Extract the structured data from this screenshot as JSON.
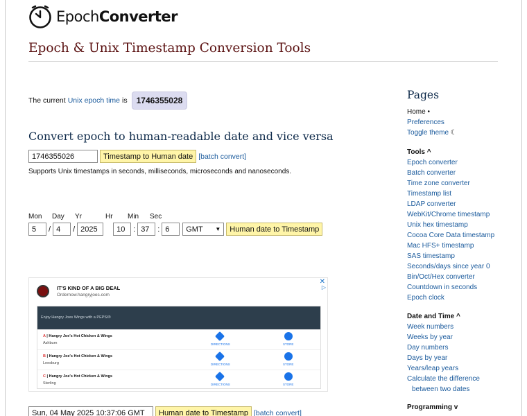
{
  "logo": {
    "text_light": "Epoch",
    "text_bold": "Converter"
  },
  "page_title": "Epoch & Unix Timestamp Conversion Tools",
  "current": {
    "prefix": "The current",
    "link": "Unix epoch time",
    "suffix": "is",
    "value": "1746355028"
  },
  "convert": {
    "heading": "Convert epoch to human-readable date and vice versa",
    "input_value": "1746355026",
    "button": "Timestamp to Human date",
    "batch": "[batch convert]",
    "support": "Supports Unix timestamps in seconds, milliseconds, microseconds and nanoseconds."
  },
  "date_form": {
    "labels": {
      "mon": "Mon",
      "day": "Day",
      "yr": "Yr",
      "hr": "Hr",
      "min": "Min",
      "sec": "Sec"
    },
    "values": {
      "mon": "5",
      "day": "4",
      "yr": "2025",
      "hr": "10",
      "min": "37",
      "sec": "6"
    },
    "sep_date": "/",
    "sep_time": ":",
    "timezone": "GMT",
    "button": "Human date to Timestamp"
  },
  "ad": {
    "headline": "IT'S KIND OF A BIG DEAL",
    "sub": "Ordernow.hangryjoes.com",
    "bar": "Enjoy Hangry Joes Wings with a PEPSI®",
    "directions": "DIRECTIONS",
    "store": "STORE",
    "close": "✕",
    "choices": "▷",
    "rows": [
      {
        "letter": "A",
        "name": "Hangry Joe's Hot Chicken & Wings",
        "city": "Ashburn"
      },
      {
        "letter": "B",
        "name": "Hangry Joe's Hot Chicken & Wings",
        "city": "Leesburg"
      },
      {
        "letter": "C",
        "name": "Hangry Joe's Hot Chicken & Wings",
        "city": "Sterling"
      }
    ]
  },
  "human_row": {
    "input_value": "Sun, 04 May 2025 10:37:06 GMT",
    "button": "Human date to Timestamp",
    "batch": "[batch convert]"
  },
  "sidebar": {
    "heading": "Pages",
    "home": "Home",
    "home_bullet": "•",
    "preferences": "Preferences",
    "toggle_theme": "Toggle theme",
    "moon": "☾",
    "tools_label": "Tools",
    "tools": [
      "Epoch converter",
      "Batch converter",
      "Time zone converter",
      "Timestamp list",
      "LDAP converter",
      "WebKit/Chrome timestamp",
      "Unix hex timestamp",
      "Cocoa Core Data timestamp",
      "Mac HFS+ timestamp",
      "SAS timestamp",
      "Seconds/days since year 0",
      "Bin/Oct/Hex converter",
      "Countdown in seconds",
      "Epoch clock"
    ],
    "date_time_label": "Date and Time",
    "date_time": [
      "Week numbers",
      "Weeks by year",
      "Day numbers",
      "Days by year",
      "Years/leap years",
      "Calculate the difference",
      "between two dates"
    ],
    "programming_label": "Programming",
    "chev_up": "^",
    "chev_down": "v"
  },
  "colors": {
    "title": "#5a1010",
    "heading": "#0e2a4a",
    "link": "#1a5a9c",
    "button": "#fff5a8",
    "badge": "#dcdcf0"
  }
}
